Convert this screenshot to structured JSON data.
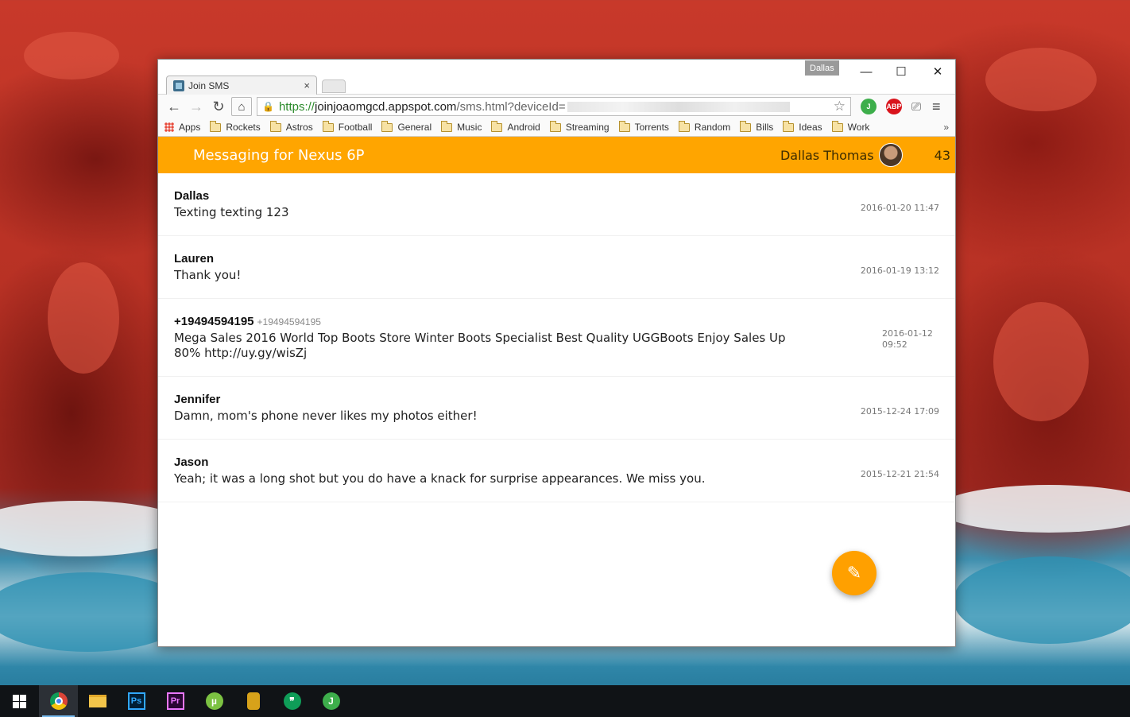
{
  "window": {
    "profile_badge": "Dallas",
    "tab_title": "Join SMS",
    "tab_close": "×",
    "controls": {
      "minimize": "—",
      "maximize": "☐",
      "close": "✕"
    }
  },
  "toolbar": {
    "back": "←",
    "forward": "→",
    "reload": "↻",
    "home": "⌂",
    "url_secure": "https://",
    "url_host": "joinjoaomgcd.appspot.com",
    "url_path": "/sms.html?deviceId=",
    "star": "☆",
    "ext_join": "J",
    "ext_abp": "ABP",
    "cast": "⎚",
    "menu": "≡"
  },
  "bookmarks": {
    "apps": "Apps",
    "folders": [
      "Rockets",
      "Astros",
      "Football",
      "General",
      "Music",
      "Android",
      "Streaming",
      "Torrents",
      "Random",
      "Bills",
      "Ideas",
      "Work"
    ],
    "more": "»"
  },
  "app": {
    "title": "Messaging for Nexus 6P",
    "user_name": "Dallas Thomas",
    "count": "43",
    "fab_icon": "✎"
  },
  "messages": [
    {
      "sender": "Dallas",
      "number": "",
      "text": "Texting texting 123",
      "time": "2016-01-20 11:47"
    },
    {
      "sender": "Lauren",
      "number": "",
      "text": "Thank you!",
      "time": "2016-01-19 13:12"
    },
    {
      "sender": "+19494594195",
      "number": "+19494594195",
      "text": "Mega Sales 2016 World Top Boots Store Winter Boots Specialist Best Quality UGGBoots Enjoy Sales Up 80% http://uy.gy/wisZj",
      "time": "2016-01-12 09:52"
    },
    {
      "sender": "Jennifer",
      "number": "",
      "text": "Damn, mom's phone never likes my photos either!",
      "time": "2015-12-24 17:09"
    },
    {
      "sender": "Jason",
      "number": "",
      "text": "Yeah; it was a long shot but you do have a knack for surprise appearances. We miss you.",
      "time": "2015-12-21 21:54"
    }
  ],
  "taskbar": {
    "ps_label": "Ps",
    "pr_label": "Pr",
    "ut_label": "µ",
    "hangouts_label": "❞",
    "join_label": "J"
  }
}
